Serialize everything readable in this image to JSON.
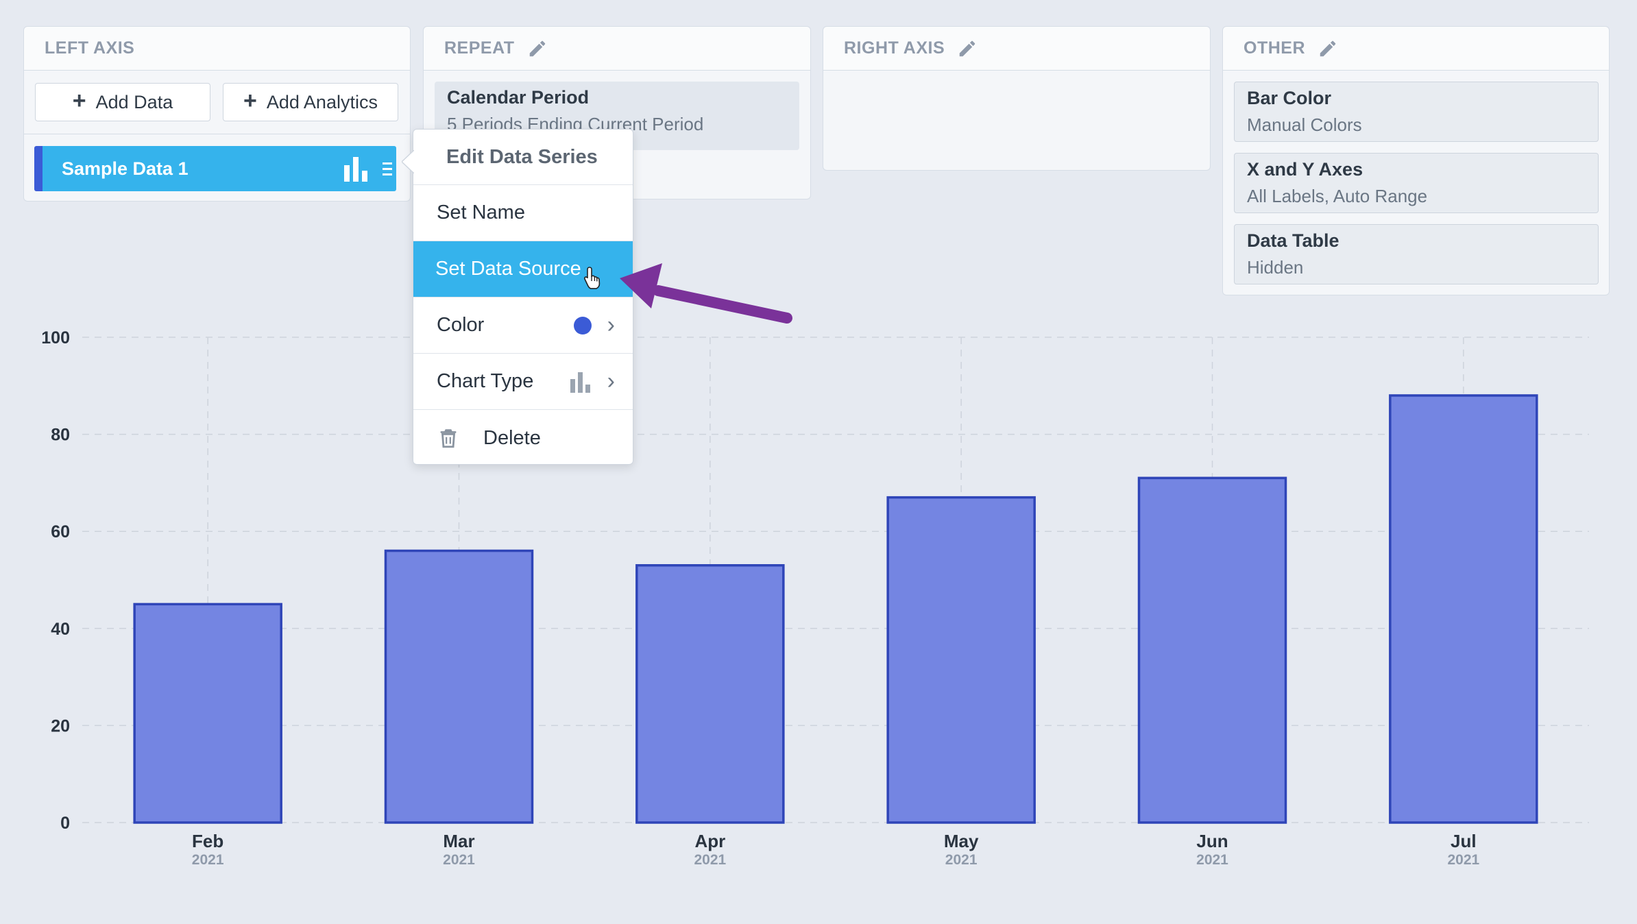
{
  "left_axis": {
    "title": "LEFT AXIS",
    "add_data_label": "Add Data",
    "add_analytics_label": "Add Analytics",
    "series": [
      {
        "name": "Sample Data 1",
        "color": "#3b5bd6"
      }
    ]
  },
  "repeat": {
    "title": "REPEAT",
    "card_title": "Calendar Period",
    "card_subtitle": "5 Periods Ending Current Period"
  },
  "right_axis": {
    "title": "RIGHT AXIS"
  },
  "other": {
    "title": "OTHER",
    "cards": [
      {
        "title": "Bar Color",
        "subtitle": "Manual Colors"
      },
      {
        "title": "X and Y Axes",
        "subtitle": "All Labels, Auto Range"
      },
      {
        "title": "Data Table",
        "subtitle": "Hidden"
      }
    ]
  },
  "context_menu": {
    "title": "Edit Data Series",
    "items": [
      {
        "label": "Set Name"
      },
      {
        "label": "Set Data Source"
      },
      {
        "label": "Color",
        "swatch": "#3b5bd6"
      },
      {
        "label": "Chart Type"
      },
      {
        "label": "Delete"
      }
    ],
    "highlighted": "Set Data Source"
  },
  "chart_data": {
    "type": "bar",
    "categories": [
      "Feb",
      "Mar",
      "Apr",
      "May",
      "Jun",
      "Jul"
    ],
    "category_sublabels": [
      "2021",
      "2021",
      "2021",
      "2021",
      "2021",
      "2021"
    ],
    "series": [
      {
        "values": [
          45,
          56,
          53,
          67,
          71,
          88
        ],
        "color": "#7485e2",
        "stroke": "#2f45b8"
      }
    ],
    "ylim": [
      0,
      100
    ],
    "yticks": [
      0,
      20,
      40,
      60,
      80,
      100
    ],
    "grid": true
  },
  "colors": {
    "accent": "#35b3ec",
    "series": "#3b5bd6",
    "annotation_arrow": "#7a3299"
  }
}
